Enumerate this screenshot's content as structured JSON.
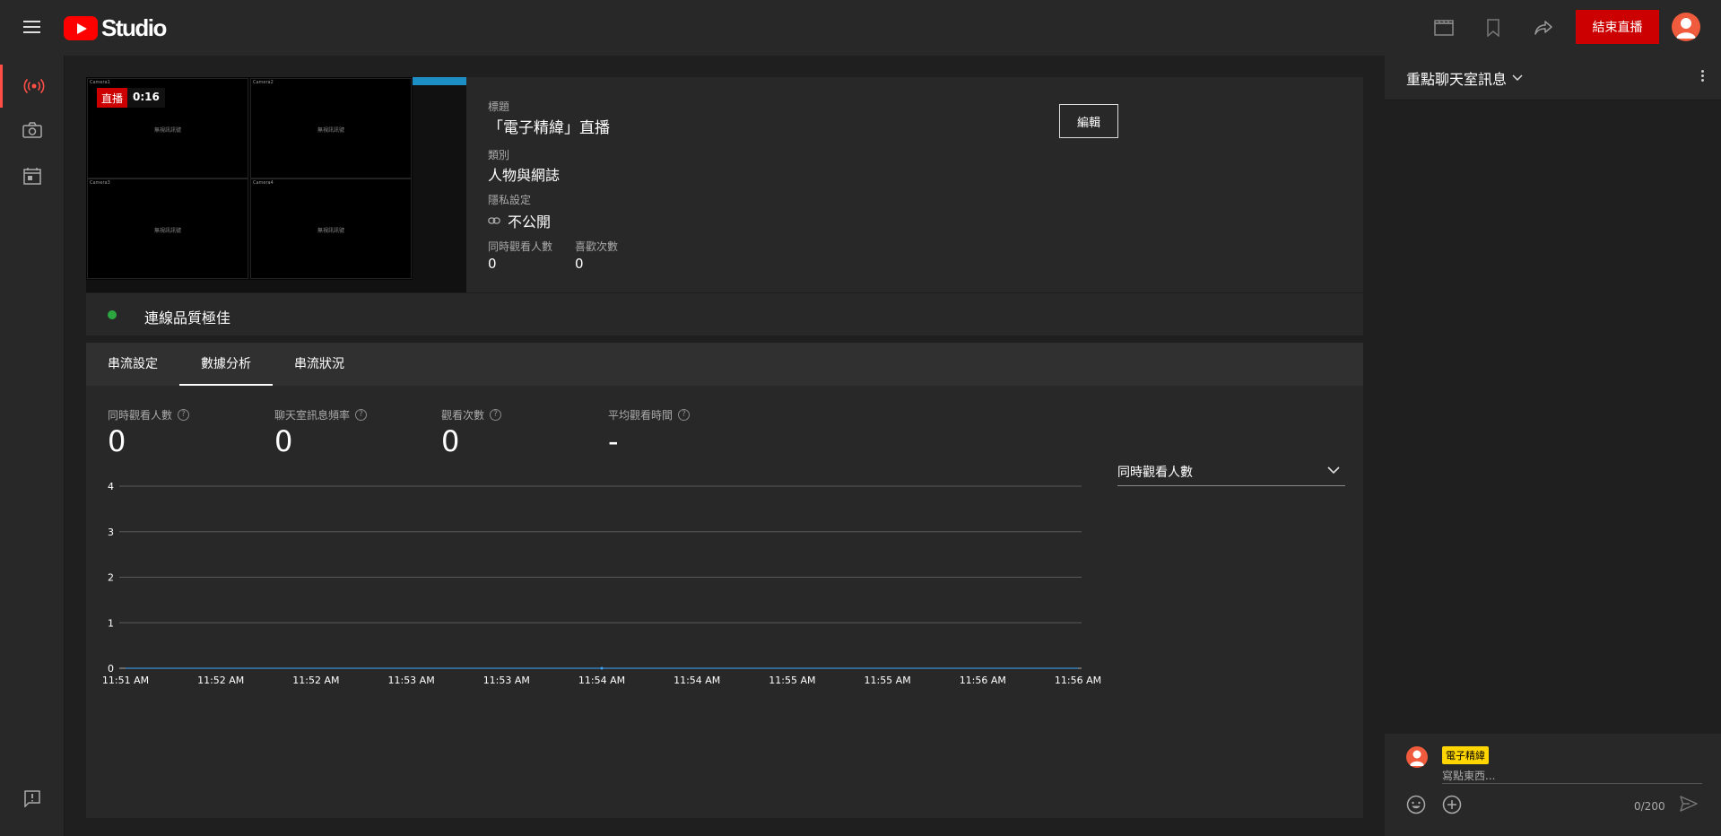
{
  "brand": {
    "name": "Studio"
  },
  "topbar": {
    "end_stream_label": "結束直播"
  },
  "preview": {
    "live_label": "直播",
    "elapsed": "0:16",
    "cameras": [
      {
        "name": "Camera1",
        "signal": "無視訊訊號"
      },
      {
        "name": "Camera2",
        "signal": "無視訊訊號"
      },
      {
        "name": "Camera3",
        "signal": "無視訊訊號"
      },
      {
        "name": "Camera4",
        "signal": "無視訊訊號"
      }
    ]
  },
  "stream_info": {
    "title_label": "標題",
    "title_value": "「電子精緯」直播",
    "category_label": "類別",
    "category_value": "人物與網誌",
    "privacy_label": "隱私設定",
    "privacy_value": "不公開",
    "concurrent_label": "同時觀看人數",
    "concurrent_value": "0",
    "likes_label": "喜歡次數",
    "likes_value": "0",
    "edit_label": "編輯"
  },
  "connection": {
    "status_text": "連線品質極佳",
    "status_color": "#2ba640"
  },
  "tabs": [
    {
      "label": "串流設定",
      "active": false
    },
    {
      "label": "數據分析",
      "active": true
    },
    {
      "label": "串流狀況",
      "active": false
    }
  ],
  "metrics": [
    {
      "label": "同時觀看人數",
      "value": "0"
    },
    {
      "label": "聊天室訊息頻率",
      "value": "0"
    },
    {
      "label": "觀看次數",
      "value": "0"
    },
    {
      "label": "平均觀看時間",
      "value": "-"
    }
  ],
  "metric_selector": {
    "selected": "同時觀看人數"
  },
  "chart_data": {
    "type": "line",
    "x": [
      "11:51 AM",
      "11:52 AM",
      "11:52 AM",
      "11:53 AM",
      "11:53 AM",
      "11:54 AM",
      "11:54 AM",
      "11:55 AM",
      "11:55 AM",
      "11:56 AM",
      "11:56 AM"
    ],
    "y_ticks": [
      0,
      1,
      2,
      3,
      4
    ],
    "ylim": [
      0,
      4
    ],
    "series": [
      {
        "values": [
          0,
          0,
          0,
          0,
          0,
          0,
          0,
          0,
          0,
          0,
          0
        ]
      }
    ],
    "marker_index": 5,
    "grid": true,
    "line_color": "#3ea6ff"
  },
  "chat": {
    "header_title": "重點聊天室訊息",
    "username": "電子精緯",
    "placeholder": "寫點東西...",
    "char_count": "0/200"
  },
  "colors": {
    "accent_red": "#cc0000",
    "live_red": "#ff4e45",
    "chat_name_bg": "#ffd600"
  }
}
